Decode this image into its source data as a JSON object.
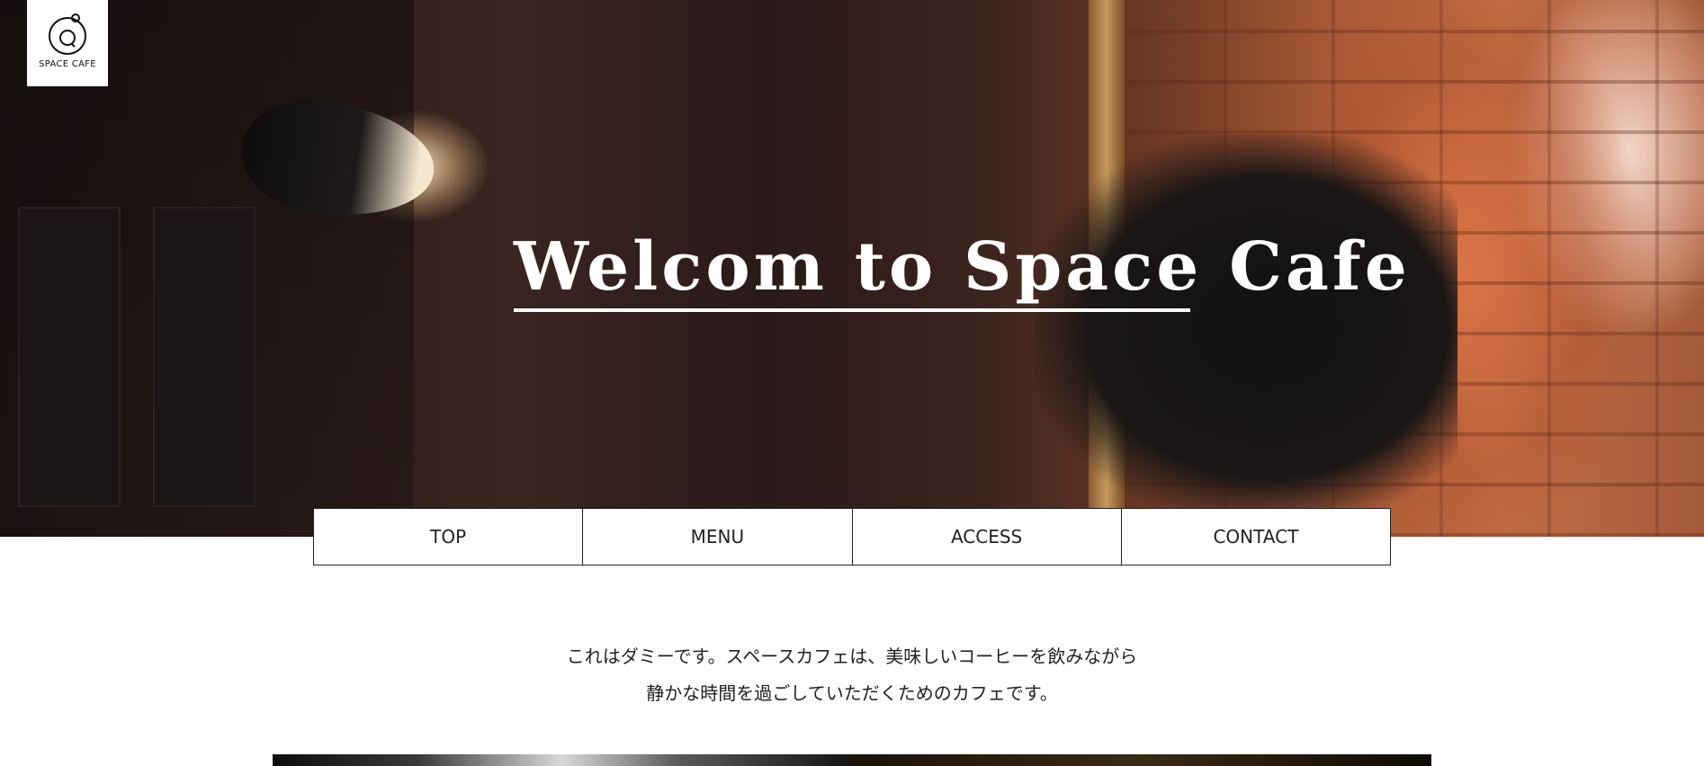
{
  "brand": {
    "logo_text": "SPACE CAFE",
    "logo_icon": "planet-ring-icon"
  },
  "hero": {
    "title": "Welcom to Space Cafe",
    "image": "cafe-interior-photo"
  },
  "nav": {
    "items": [
      {
        "label": "TOP"
      },
      {
        "label": "MENU"
      },
      {
        "label": "ACCESS"
      },
      {
        "label": "CONTACT"
      }
    ]
  },
  "intro": {
    "line1": "これはダミーです。スペースカフェは、美味しいコーヒーを飲みながら",
    "line2": "静かな時間を過ごしていただくためのカフェです。"
  },
  "colors": {
    "nav_border": "#222222",
    "text": "#222222",
    "hero_title": "#ffffff",
    "background": "#ffffff"
  }
}
